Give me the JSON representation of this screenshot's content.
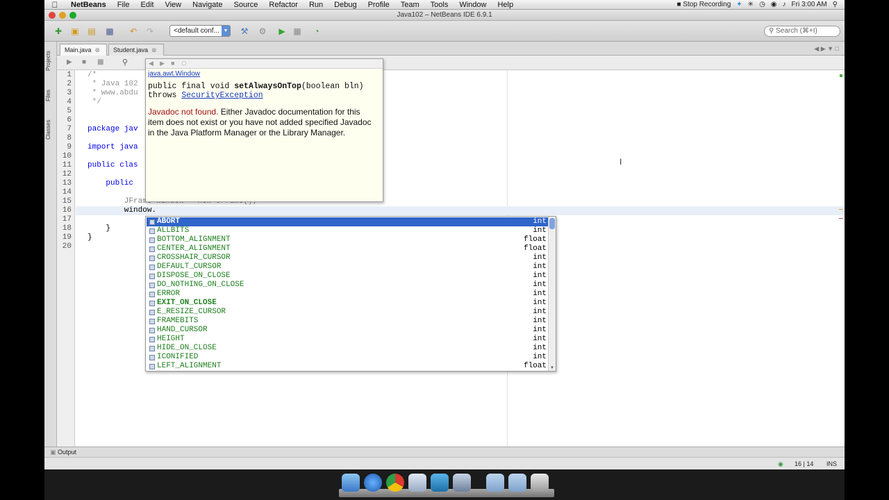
{
  "menubar": {
    "app": "NetBeans",
    "items": [
      "File",
      "Edit",
      "View",
      "Navigate",
      "Source",
      "Refactor",
      "Run",
      "Debug",
      "Profile",
      "Team",
      "Tools",
      "Window",
      "Help"
    ],
    "recording": "Stop Recording",
    "clock": "Fri 3:00 AM"
  },
  "window": {
    "title": "Java102 – NetBeans IDE 6.9.1"
  },
  "toolbar": {
    "config": "<default conf...",
    "search_placeholder": "Search (⌘+I)"
  },
  "sidebar": {
    "tabs": [
      "Projects",
      "Files",
      "Classes"
    ]
  },
  "editor_tabs": [
    {
      "label": "Main.java",
      "active": true
    },
    {
      "label": "Student.java",
      "active": false
    }
  ],
  "code": {
    "line_numbers": [
      "1",
      "2",
      "3",
      "4",
      "5",
      "6",
      "7",
      "8",
      "9",
      "10",
      "11",
      "12",
      "13",
      "14",
      "15",
      "16",
      "17",
      "18",
      "19",
      "20"
    ],
    "lines": [
      "/*",
      " * Java 102",
      " * www.abdu",
      " */",
      "",
      "",
      "package jav",
      "",
      "import java",
      "",
      "public clas",
      "",
      "    public ",
      "",
      "        JFrame window = new JFrame();",
      "        window.",
      "",
      "    }",
      "}",
      ""
    ]
  },
  "javadoc": {
    "class_link": "java.awt.Window",
    "sig_prefix": "public final void ",
    "method": "setAlwaysOnTop",
    "sig_params": "(boolean bln) throws ",
    "exception_link": "SecurityException",
    "error_text": "Javadoc not found.",
    "message": " Either Javadoc documentation for this item does not exist or you have not added specified Javadoc in the Java Platform Manager or the Library Manager."
  },
  "completion": {
    "items": [
      {
        "name": "ABORT",
        "type": "int",
        "bold": true,
        "selected": true
      },
      {
        "name": "ALLBITS",
        "type": "int",
        "bold": false
      },
      {
        "name": "BOTTOM_ALIGNMENT",
        "type": "float",
        "bold": false
      },
      {
        "name": "CENTER_ALIGNMENT",
        "type": "float",
        "bold": false
      },
      {
        "name": "CROSSHAIR_CURSOR",
        "type": "int",
        "bold": false
      },
      {
        "name": "DEFAULT_CURSOR",
        "type": "int",
        "bold": false
      },
      {
        "name": "DISPOSE_ON_CLOSE",
        "type": "int",
        "bold": false
      },
      {
        "name": "DO_NOTHING_ON_CLOSE",
        "type": "int",
        "bold": false
      },
      {
        "name": "ERROR",
        "type": "int",
        "bold": false
      },
      {
        "name": "EXIT_ON_CLOSE",
        "type": "int",
        "bold": true
      },
      {
        "name": "E_RESIZE_CURSOR",
        "type": "int",
        "bold": false
      },
      {
        "name": "FRAMEBITS",
        "type": "int",
        "bold": false
      },
      {
        "name": "HAND_CURSOR",
        "type": "int",
        "bold": false
      },
      {
        "name": "HEIGHT",
        "type": "int",
        "bold": false
      },
      {
        "name": "HIDE_ON_CLOSE",
        "type": "int",
        "bold": false
      },
      {
        "name": "ICONIFIED",
        "type": "int",
        "bold": false
      },
      {
        "name": "LEFT_ALIGNMENT",
        "type": "float",
        "bold": false
      }
    ]
  },
  "output": {
    "label": "Output"
  },
  "status": {
    "position": "16 | 14",
    "mode": "INS"
  },
  "dock": {
    "icons": [
      "finder-icon",
      "ie-icon",
      "chrome-icon",
      "virtualbox-icon",
      "twitter-icon",
      "preview-icon",
      "folder-icon",
      "documents-icon",
      "trash-icon"
    ]
  }
}
